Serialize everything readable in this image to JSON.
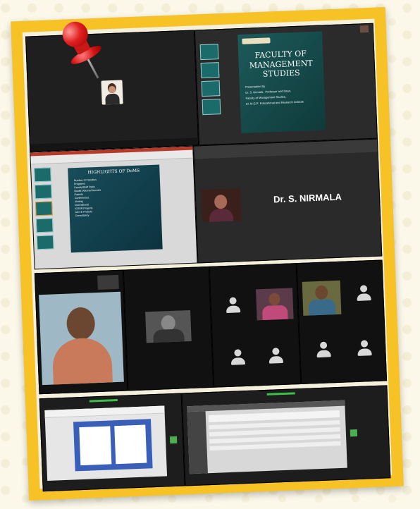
{
  "slide": {
    "title_line1": "FACULTY OF",
    "title_line2": "MANAGEMENT STUDIES",
    "sub1": "Presentation By",
    "sub2": "Dr. S. Nirmala , Professor and Dean,",
    "sub3": "Faculty of Management Studies,",
    "sub4": "Dr. M.G.R. Educational and Research Institute"
  },
  "highlights": {
    "title": "HIGHLIGHTS OF DoMS",
    "items": [
      "Number of Faculties",
      "Programs",
      "Faculty/Staff Ratio",
      "Books Volume/Journals",
      "Patents",
      "Conferences",
      "Visiting",
      "International",
      "ICSSR Projects",
      "AICTE Projects",
      "Consultancy"
    ]
  },
  "speaker": {
    "name": "Dr. S. NIRMALA"
  },
  "colors": {
    "frame": "#f6c226",
    "slide_bg": "#1d5a5a",
    "pin": "#e02020"
  },
  "icons": [
    "pushpin-icon",
    "person-silhouette-icon"
  ]
}
